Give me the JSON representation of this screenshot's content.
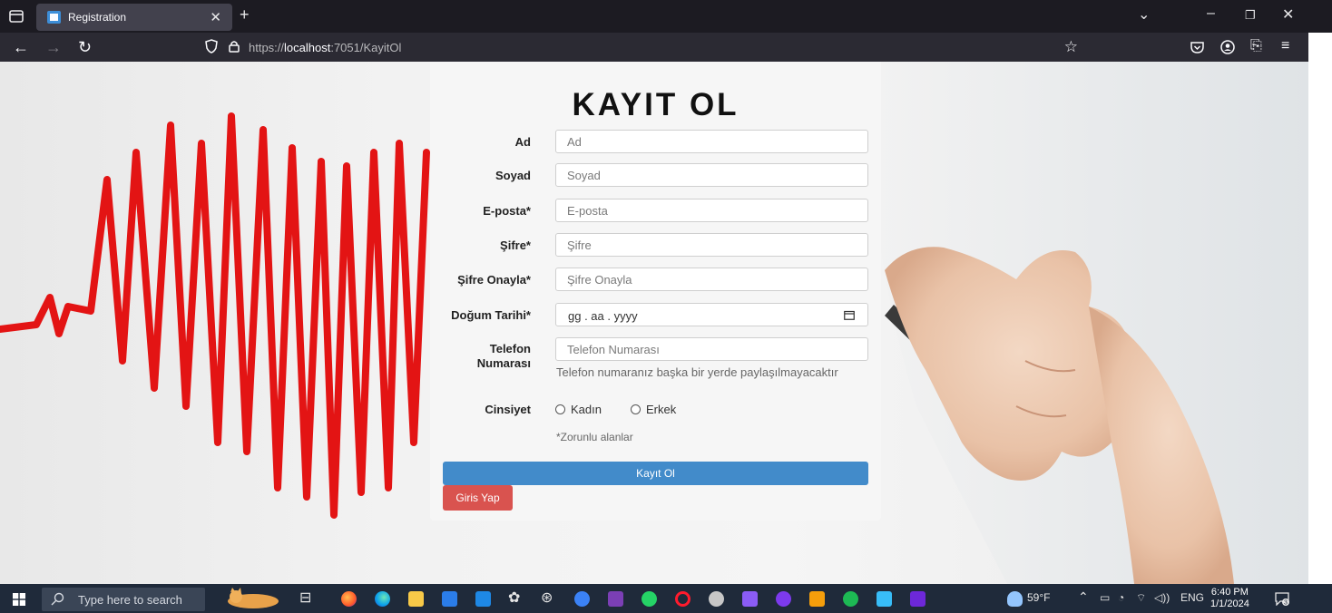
{
  "browser": {
    "tab_title": "Registration",
    "url_prefix": "https://",
    "url_host": "localhost",
    "url_rest": ":7051/KayitOl"
  },
  "form": {
    "title": "KAYIT OL",
    "fields": [
      {
        "label": "Ad",
        "placeholder": "Ad"
      },
      {
        "label": "Soyad",
        "placeholder": "Soyad"
      },
      {
        "label": "E-posta*",
        "placeholder": "E-posta"
      },
      {
        "label": "Şifre*",
        "placeholder": "Şifre"
      },
      {
        "label": "Şifre Onayla*",
        "placeholder": "Şifre Onayla"
      },
      {
        "label": "Doğum Tarihi*",
        "placeholder": "gg . aa . yyyy"
      },
      {
        "label_line1": "Telefon",
        "label_line2": "Numarası",
        "placeholder": "Telefon Numarası"
      }
    ],
    "phone_help": "Telefon numaranız başka bir yerde paylaşılmayacaktır",
    "gender_label": "Cinsiyet",
    "gender_options": [
      "Kadın",
      "Erkek"
    ],
    "required_note": "*Zorunlu alanlar",
    "submit_label": "Kayıt Ol",
    "login_label": "Giris Yap"
  },
  "taskbar": {
    "search_placeholder": "Type here to search",
    "weather": "59°F",
    "language": "ENG",
    "time": "6:40 PM",
    "date": "1/1/2024",
    "notification_count": "3"
  },
  "colors": {
    "primary_button": "#428bca",
    "danger_button": "#d9534f",
    "heartbeat_line": "#e31414"
  }
}
